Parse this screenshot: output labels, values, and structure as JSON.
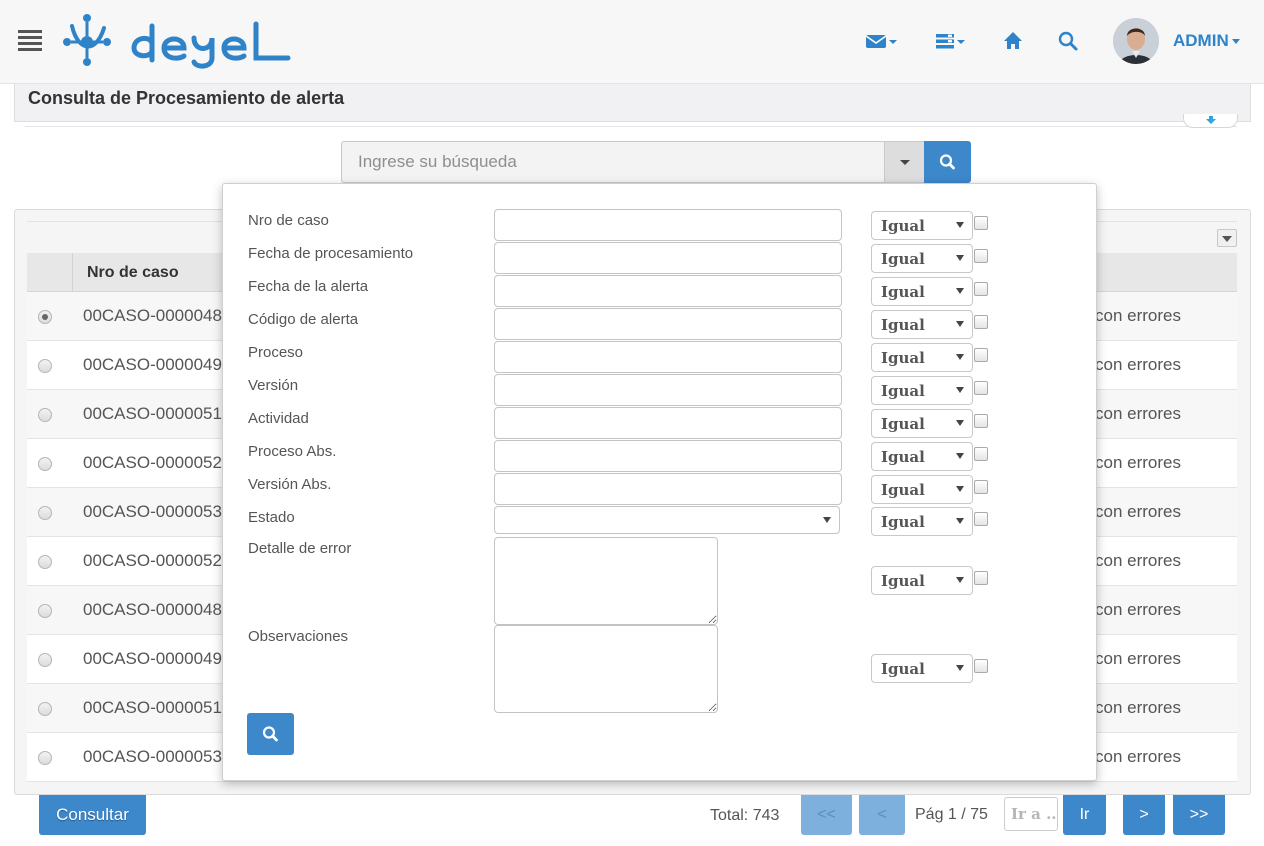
{
  "header": {
    "user_label": "ADMIN",
    "icons": [
      "menu-icon",
      "deyel-logo",
      "mail-icon",
      "tasks-icon",
      "home-icon",
      "search-icon",
      "avatar"
    ]
  },
  "page": {
    "title": "Consulta de Procesamiento de alerta"
  },
  "search": {
    "placeholder": "Ingrese su búsqueda"
  },
  "grid": {
    "columns": [
      "Nro de caso"
    ],
    "rows": [
      {
        "caso": "00CASO-0000048",
        "estado": "con errores",
        "selected": true
      },
      {
        "caso": "00CASO-0000049",
        "estado": "con errores",
        "selected": false
      },
      {
        "caso": "00CASO-0000051",
        "estado": "con errores",
        "selected": false
      },
      {
        "caso": "00CASO-0000052",
        "estado": "con errores",
        "selected": false
      },
      {
        "caso": "00CASO-0000053",
        "estado": "con errores",
        "selected": false
      },
      {
        "caso": "00CASO-0000052",
        "estado": "con errores",
        "selected": false
      },
      {
        "caso": "00CASO-0000048",
        "estado": "con errores",
        "selected": false
      },
      {
        "caso": "00CASO-0000049",
        "estado": "con errores",
        "selected": false
      },
      {
        "caso": "00CASO-0000051",
        "estado": "con errores",
        "selected": false
      },
      {
        "caso": "00CASO-0000053",
        "estado": "con errores",
        "selected": false
      }
    ]
  },
  "filter": {
    "fields": [
      {
        "label": "Nro de caso",
        "type": "text",
        "operator": "Igual"
      },
      {
        "label": "Fecha de procesamiento",
        "type": "text",
        "operator": "Igual"
      },
      {
        "label": "Fecha de la alerta",
        "type": "text",
        "operator": "Igual"
      },
      {
        "label": "Código de alerta",
        "type": "text",
        "operator": "Igual"
      },
      {
        "label": "Proceso",
        "type": "text",
        "operator": "Igual"
      },
      {
        "label": "Versión",
        "type": "text",
        "operator": "Igual"
      },
      {
        "label": "Actividad",
        "type": "text",
        "operator": "Igual"
      },
      {
        "label": "Proceso Abs.",
        "type": "text",
        "operator": "Igual"
      },
      {
        "label": "Versión Abs.",
        "type": "text",
        "operator": "Igual"
      },
      {
        "label": "Estado",
        "type": "select",
        "operator": "Igual"
      },
      {
        "label": "Detalle de error",
        "type": "textarea",
        "operator": "Igual"
      },
      {
        "label": "Observaciones",
        "type": "textarea",
        "operator": "Igual"
      }
    ]
  },
  "footer": {
    "consultar_label": "Consultar",
    "total_text": "Total: 743",
    "first_label": "<<",
    "prev_label": "<",
    "page_text": "Pág 1 / 75",
    "goto_placeholder": "Ir a ..",
    "go_label": "Ir",
    "next_label": ">",
    "last_label": ">>"
  },
  "colors": {
    "accent": "#3d87cb",
    "brand": "#2f83c8"
  }
}
